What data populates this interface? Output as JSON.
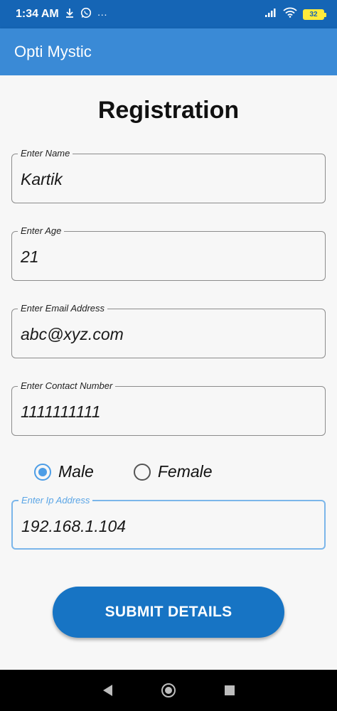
{
  "status_bar": {
    "time": "1:34 AM",
    "notification_icons": [
      "download-icon",
      "whatsapp-icon",
      "more-icon"
    ],
    "more": "···",
    "battery_level": "32"
  },
  "app_bar": {
    "title": "Opti Mystic"
  },
  "form": {
    "heading": "Registration",
    "name": {
      "label": "Enter Name",
      "value": "Kartik"
    },
    "age": {
      "label": "Enter Age",
      "value": "21"
    },
    "email": {
      "label": "Enter Email Address",
      "value": "abc@xyz.com"
    },
    "contact": {
      "label": "Enter Contact Number",
      "value": "1111111111"
    },
    "gender": {
      "options": [
        "Male",
        "Female"
      ],
      "selected": "Male"
    },
    "ip": {
      "label": "Enter Ip Address",
      "value": "192.168.1.104"
    },
    "submit_label": "SUBMIT DETAILS"
  },
  "colors": {
    "status_bar": "#1565b5",
    "app_bar": "#3a8ad6",
    "accent": "#1774c4",
    "radio_selected": "#4c9de6"
  }
}
